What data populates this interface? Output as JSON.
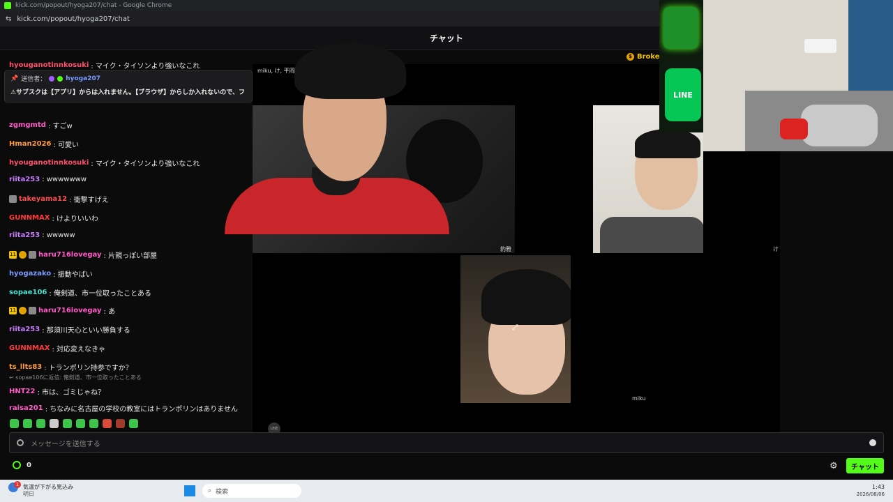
{
  "browser": {
    "title": "kick.com/popout/hyoga207/chat - Google Chrome",
    "url": "kick.com/popout/hyoga207/chat"
  },
  "header": {
    "title": "チャット"
  },
  "pinned": {
    "sender_label": "送信者：",
    "sender_name": "hyoga207",
    "text": "⚠サブスクは【アプリ】からは入れません。【ブラウザ】からしか入れないので、フ"
  },
  "partial_top_user": "hyouganotinnkosuki",
  "partial_top_text": ": マイク・タイソンより強いなこれ",
  "messages": [
    {
      "user": "zgmgmtd",
      "color": "#ff5cc8",
      "text": ": すごw"
    },
    {
      "user": "Hman2026",
      "color": "#ff9a3c",
      "text": ": 可愛い"
    },
    {
      "user": "hyouganotinnkosuki",
      "color": "#ff4f6a",
      "text": ": マイク・タイソンより強いなこれ"
    },
    {
      "user": "riita253",
      "color": "#c77dff",
      "text": ": wwwwwww"
    },
    {
      "user": "takeyama12",
      "color": "#ff4f4f",
      "text": ": 衝撃すげえ"
    },
    {
      "user": "GUNNMAX",
      "color": "#ff3b3b",
      "text": ": けよりいいわ"
    },
    {
      "user": "riita253",
      "color": "#c77dff",
      "text": ": wwwww"
    },
    {
      "user": "haru716lovegay",
      "color": "#ff5cc8",
      "text": ": 片親っぽい部屋"
    },
    {
      "user": "hyogazako",
      "color": "#7a9bff",
      "text": ": 振動やばい"
    },
    {
      "user": "sopae106",
      "color": "#4fe0d0",
      "text": ": 俺剣道、市一位取ったことある"
    },
    {
      "user": "haru716lovegay",
      "color": "#ff5cc8",
      "text": ": あ"
    },
    {
      "user": "riita253",
      "color": "#c77dff",
      "text": ": 那須川天心といい勝負する"
    },
    {
      "user": "GUNNMAX",
      "color": "#ff3b3b",
      "text": ": 対応変えなきゃ"
    },
    {
      "user": "ts_llts83",
      "color": "#ff9a3c",
      "text": ": トランポリン持参ですか？"
    },
    {
      "user": "HNT22",
      "color": "#ff5cc8",
      "text": ": 市は、ゴミじゃね？"
    },
    {
      "user": "raisa201",
      "color": "#ff5cc8",
      "text": ": ちなみに名古屋の学校の教室にはトランポリンはありません"
    }
  ],
  "reply_hint": "sopae106に返信: 俺剣道、市一位取ったことある",
  "badge_num": "11",
  "video": {
    "caption_top": "miku, け, 平岡桜蓮",
    "tile1_name": "豹雅",
    "tile2_name": "け",
    "tile3_name": "miku",
    "brokey": "Brokey"
  },
  "ad": {
    "text": "LINE"
  },
  "input": {
    "placeholder": "メッセージを送信する"
  },
  "bottom": {
    "count": "0",
    "send_label": "チャット"
  },
  "taskbar": {
    "weather_line1": "気温が下がる見込み",
    "weather_line2": "明日",
    "search_placeholder": "検索",
    "time": "1:43",
    "date": "2026/08/06",
    "notif_badge": "1"
  }
}
